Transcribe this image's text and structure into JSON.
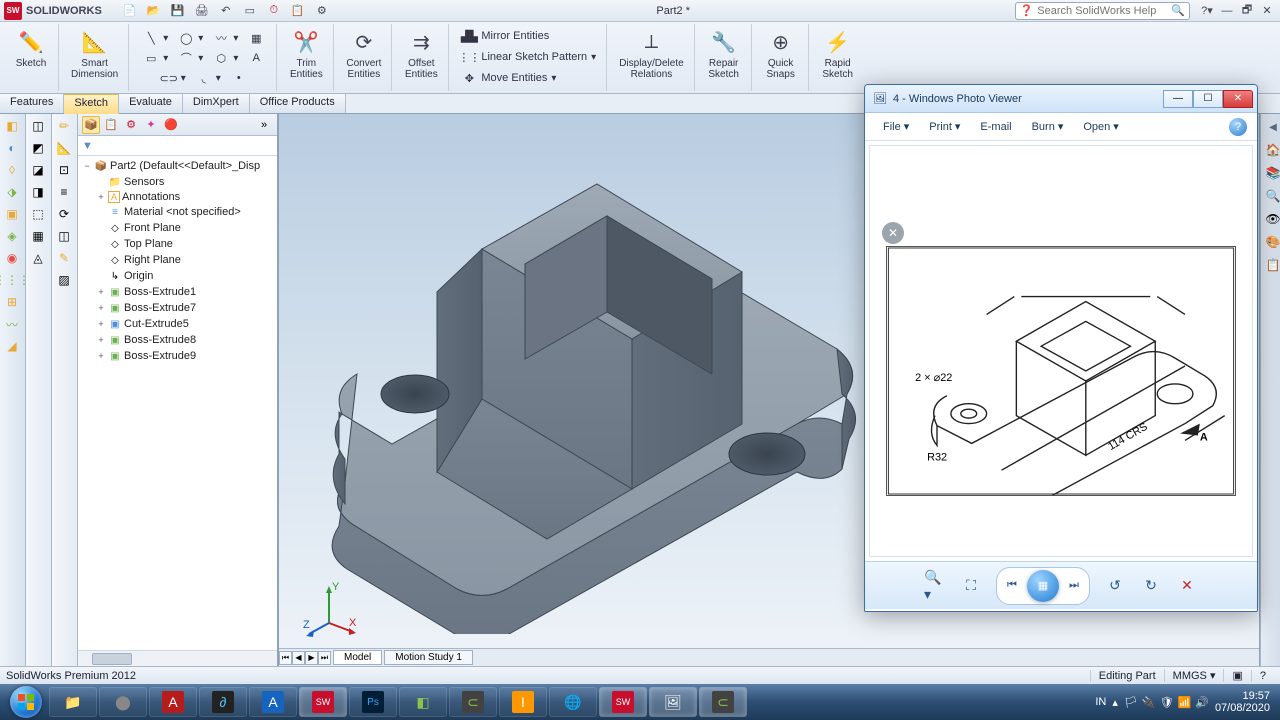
{
  "app": {
    "name": "SOLIDWORKS",
    "doc_title": "Part2 *"
  },
  "search": {
    "placeholder": "Search SolidWorks Help"
  },
  "ribbon": {
    "sketch": "Sketch",
    "smart_dim": "Smart\nDimension",
    "trim": "Trim\nEntities",
    "convert": "Convert\nEntities",
    "offset": "Offset\nEntities",
    "mirror": "Mirror Entities",
    "linear": "Linear Sketch Pattern",
    "move": "Move Entities",
    "display_del": "Display/Delete\nRelations",
    "repair": "Repair\nSketch",
    "quick": "Quick\nSnaps",
    "rapid": "Rapid\nSketch"
  },
  "tabs": {
    "features": "Features",
    "sketch": "Sketch",
    "evaluate": "Evaluate",
    "dimxpert": "DimXpert",
    "office": "Office Products"
  },
  "tree": {
    "root": "Part2  (Default<<Default>_Disp",
    "sensors": "Sensors",
    "annotations": "Annotations",
    "material": "Material <not specified>",
    "front": "Front Plane",
    "top": "Top Plane",
    "right": "Right Plane",
    "origin": "Origin",
    "be1": "Boss-Extrude1",
    "be7": "Boss-Extrude7",
    "ce5": "Cut-Extrude5",
    "be8": "Boss-Extrude8",
    "be9": "Boss-Extrude9"
  },
  "bottom_tabs": {
    "model": "Model",
    "motion": "Motion Study 1"
  },
  "status": {
    "app": "SolidWorks Premium 2012",
    "state": "Editing Part",
    "units": "MMGS"
  },
  "photo_viewer": {
    "title": "4 - Windows Photo Viewer",
    "menu": {
      "file": "File",
      "print": "Print",
      "email": "E-mail",
      "burn": "Burn",
      "open": "Open"
    },
    "dims": {
      "two_holes": "2 × ⌀22",
      "r32": "R32",
      "crs": "114 CRS",
      "arrow": "A"
    }
  },
  "tray": {
    "lang": "IN",
    "time": "19:57",
    "date": "07/08/2020"
  }
}
